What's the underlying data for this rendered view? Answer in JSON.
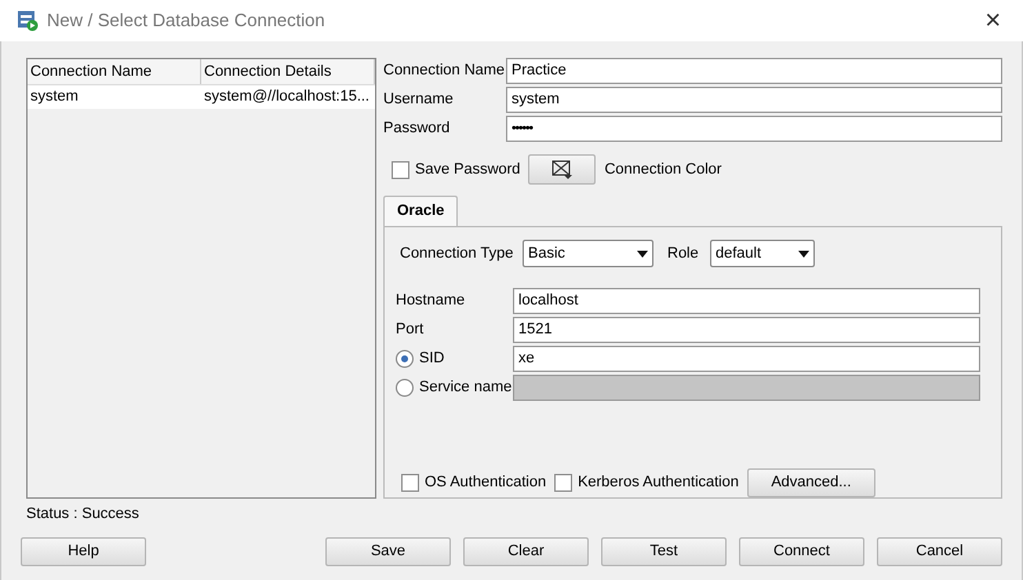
{
  "window": {
    "title": "New / Select Database Connection",
    "close": "×"
  },
  "connections": {
    "columns": [
      "Connection Name",
      "Connection Details"
    ],
    "rows": [
      {
        "cells": [
          "system",
          "system@//localhost:15..."
        ],
        "selected": false
      }
    ]
  },
  "fields": [
    {
      "label": "Connection Name",
      "value": "Practice",
      "kind": "text"
    },
    {
      "label": "Username",
      "value": "system",
      "kind": "text"
    },
    {
      "label": "Password",
      "value": "••••••",
      "kind": "password"
    }
  ],
  "save_password": {
    "label": "Save Password",
    "checked": false
  },
  "connection_color": {
    "label": "Connection Color"
  },
  "tabs": [
    {
      "label": "Oracle",
      "selected": true
    }
  ],
  "connection_type": {
    "label": "Connection Type",
    "value": "Basic"
  },
  "role": {
    "label": "Role",
    "value": "default"
  },
  "oracle_fields": [
    {
      "label": "Hostname",
      "value": "localhost",
      "kind": "text"
    },
    {
      "label": "Port",
      "value": "1521",
      "kind": "text"
    },
    {
      "label": "SID",
      "value": "xe",
      "kind": "radio",
      "selected": true,
      "disabled": false
    },
    {
      "label": "Service name",
      "kind": "radio",
      "selected": false,
      "disabled": true
    }
  ],
  "options": [
    {
      "label": "OS Authentication",
      "checked": false
    },
    {
      "label": "Kerberos Authentication",
      "checked": false
    }
  ],
  "advanced_button": "Advanced...",
  "status": "Status : Success",
  "buttons": [
    {
      "label": "Help",
      "kind": "left"
    },
    {
      "label": "Save",
      "kind": "right"
    },
    {
      "label": "Clear",
      "kind": "right"
    },
    {
      "label": "Test",
      "kind": "right"
    },
    {
      "label": "Connect",
      "kind": "right"
    },
    {
      "label": "Cancel",
      "kind": "right"
    }
  ]
}
